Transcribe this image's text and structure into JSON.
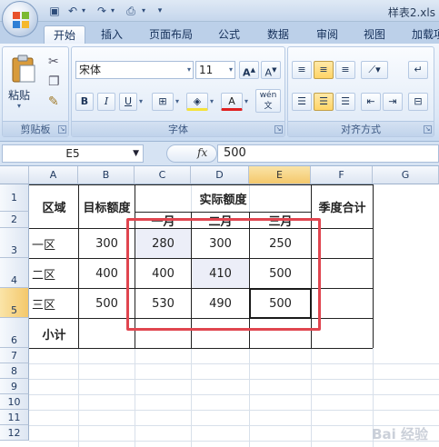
{
  "window": {
    "title": "样表2.xls"
  },
  "tabs": [
    "开始",
    "插入",
    "页面布局",
    "公式",
    "数据",
    "审阅",
    "视图",
    "加载项"
  ],
  "ribbon": {
    "clipboard": {
      "label": "剪贴板",
      "paste_label": "粘贴"
    },
    "font": {
      "label": "字体",
      "font_name": "宋体",
      "font_size": "11",
      "bold": "B",
      "italic": "I",
      "underline": "U",
      "phonetic": "wén"
    },
    "alignment": {
      "label": "对齐方式"
    }
  },
  "formula_bar": {
    "name_box": "E5",
    "fx": "fx",
    "formula": "500"
  },
  "columns": [
    "A",
    "B",
    "C",
    "D",
    "E",
    "F",
    "G"
  ],
  "rows": [
    "1",
    "2",
    "3",
    "4",
    "5",
    "6",
    "7",
    "8",
    "9",
    "10",
    "11",
    "12"
  ],
  "table": {
    "header_region": "区域",
    "header_target": "目标额度",
    "header_actual": "实际额度",
    "header_season": "季度合计",
    "months": [
      "一月",
      "二月",
      "三月"
    ],
    "rows": [
      {
        "region": "一区",
        "target": "300",
        "m1": "280",
        "m2": "300",
        "m3": "250"
      },
      {
        "region": "二区",
        "target": "400",
        "m1": "400",
        "m2": "410",
        "m3": "500"
      },
      {
        "region": "三区",
        "target": "500",
        "m1": "530",
        "m2": "490",
        "m3": "500"
      }
    ],
    "subtotal": "小计"
  },
  "watermark": "Bai 经验"
}
